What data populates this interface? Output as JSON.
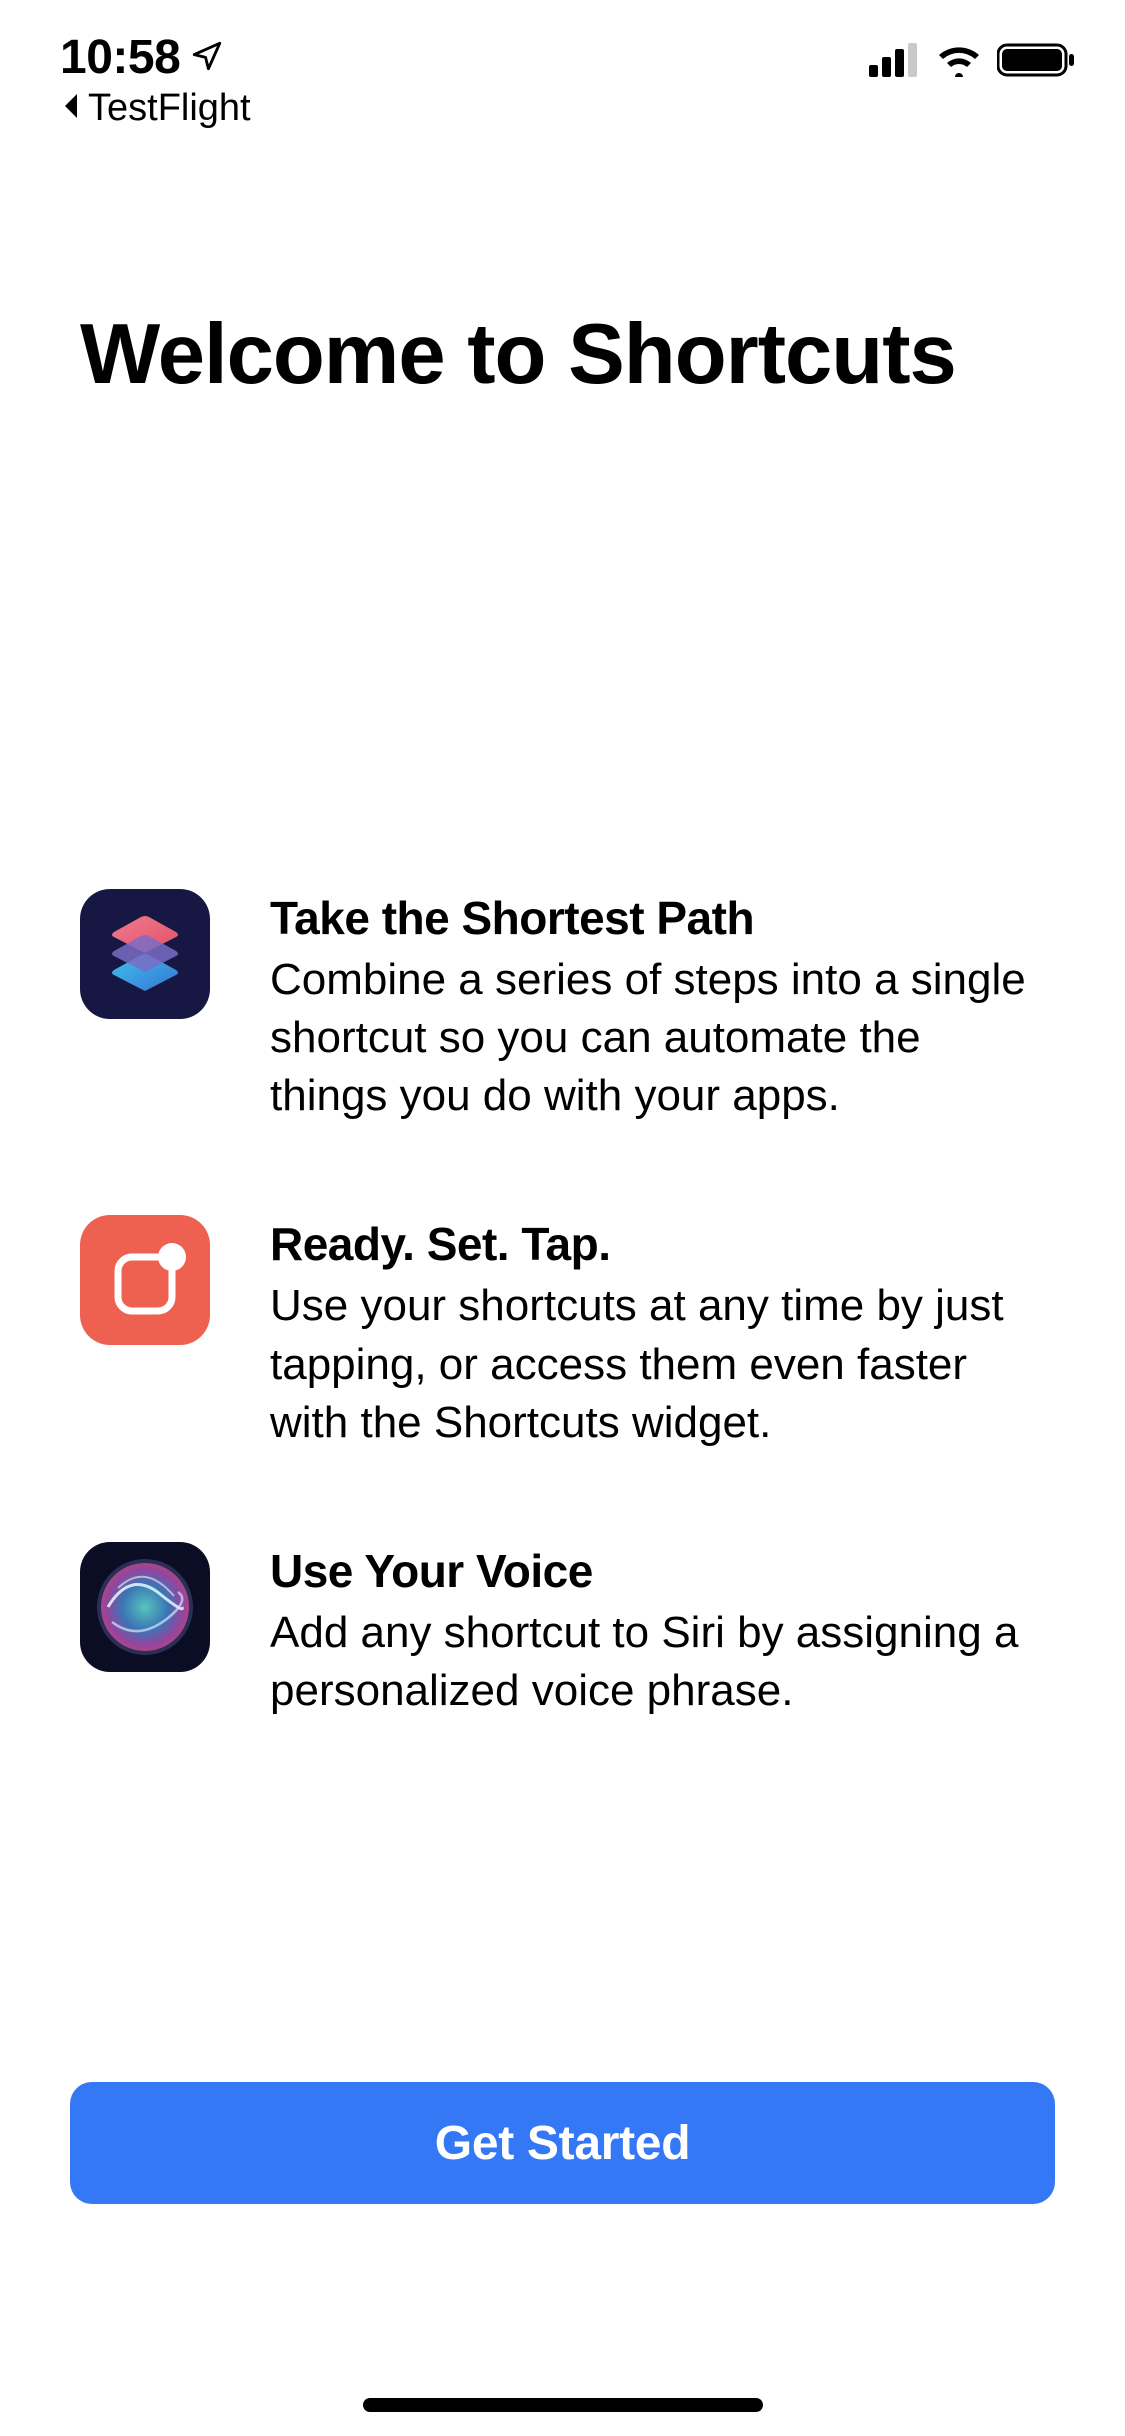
{
  "status": {
    "time": "10:58",
    "back_app": "TestFlight"
  },
  "page": {
    "title": "Welcome to Shortcuts"
  },
  "features": [
    {
      "title": "Take the Shortest Path",
      "desc": "Combine a series of steps into a single shortcut so you can automate the things you do with your apps."
    },
    {
      "title": "Ready. Set. Tap.",
      "desc": "Use your shortcuts at any time by just tapping, or access them even faster with the Shortcuts widget."
    },
    {
      "title": "Use Your Voice",
      "desc": "Add any shortcut to Siri by assigning a personalized voice phrase."
    }
  ],
  "cta": {
    "label": "Get Started"
  },
  "colors": {
    "accent": "#3478F6",
    "icon1_bg": "#161843",
    "icon2_bg": "#EE6151",
    "icon3_bg": "#0b0d24"
  }
}
